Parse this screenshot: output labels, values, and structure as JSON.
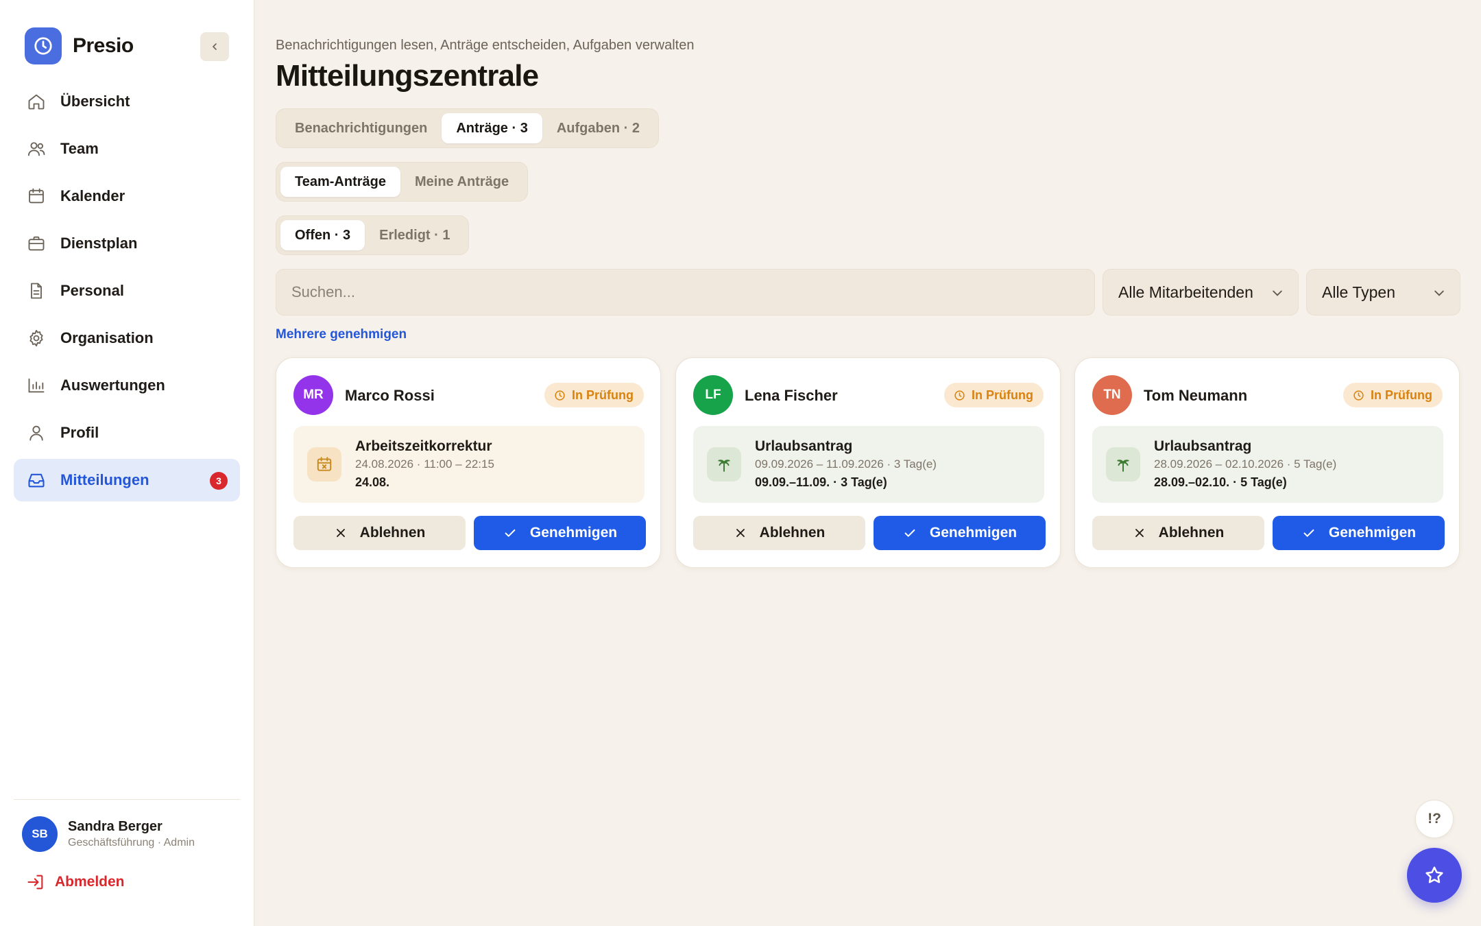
{
  "app": {
    "name": "Presio"
  },
  "sidebar": {
    "items": [
      {
        "label": "Übersicht",
        "icon": "home-icon"
      },
      {
        "label": "Team",
        "icon": "users-icon"
      },
      {
        "label": "Kalender",
        "icon": "calendar-icon"
      },
      {
        "label": "Dienstplan",
        "icon": "briefcase-icon"
      },
      {
        "label": "Personal",
        "icon": "document-icon"
      },
      {
        "label": "Organisation",
        "icon": "gear-icon"
      },
      {
        "label": "Auswertungen",
        "icon": "bar-chart-icon"
      },
      {
        "label": "Profil",
        "icon": "user-icon"
      },
      {
        "label": "Mitteilungen",
        "icon": "inbox-icon",
        "active": true,
        "badge": "3"
      }
    ],
    "user": {
      "initials": "SB",
      "name": "Sandra Berger",
      "role": "Geschäftsführung · Admin"
    },
    "logout_label": "Abmelden"
  },
  "header": {
    "subtitle": "Benachrichtigungen lesen, Anträge entscheiden, Aufgaben verwalten",
    "title": "Mitteilungszentrale"
  },
  "tabs": [
    {
      "label": "Benachrichtigungen"
    },
    {
      "label": "Anträge · 3",
      "active": true
    },
    {
      "label": "Aufgaben · 2"
    }
  ],
  "subtabs": [
    {
      "label": "Team-Anträge",
      "active": true
    },
    {
      "label": "Meine Anträge"
    }
  ],
  "status_tabs": [
    {
      "label": "Offen · 3",
      "active": true
    },
    {
      "label": "Erledigt · 1"
    }
  ],
  "filters": {
    "search_placeholder": "Suchen...",
    "employee_select": "Alle Mitarbeitenden",
    "type_select": "Alle Typen"
  },
  "multi_approve_label": "Mehrere genehmigen",
  "requests": [
    {
      "initials": "MR",
      "name": "Marco Rossi",
      "avatar_color": "#9333ea",
      "status": "In Prüfung",
      "type": "Arbeitszeitkorrektur",
      "icon": "calendar-x-icon",
      "range": "24.08.2026 · 11:00 – 22:15",
      "short": "24.08.",
      "reject_label": "Ablehnen",
      "approve_label": "Genehmigen"
    },
    {
      "initials": "LF",
      "name": "Lena Fischer",
      "avatar_color": "#16a34a",
      "status": "In Prüfung",
      "type": "Urlaubsantrag",
      "icon": "palm-tree-icon",
      "range": "09.09.2026 – 11.09.2026 · 3 Tag(e)",
      "short": "09.09.–11.09. · 3 Tag(e)",
      "reject_label": "Ablehnen",
      "approve_label": "Genehmigen"
    },
    {
      "initials": "TN",
      "name": "Tom Neumann",
      "avatar_color": "#e06c4f",
      "status": "In Prüfung",
      "type": "Urlaubsantrag",
      "icon": "palm-tree-icon",
      "range": "28.09.2026 – 02.10.2026 · 5 Tag(e)",
      "short": "28.09.–02.10. · 5 Tag(e)",
      "reject_label": "Ablehnen",
      "approve_label": "Genehmigen"
    }
  ],
  "floating": {
    "help_label": "!?"
  },
  "colors": {
    "accent": "#2456d8",
    "primary_button": "#1f5be6",
    "danger": "#d9282d",
    "status": "#d9820e",
    "fab": "#4d4ee3"
  }
}
